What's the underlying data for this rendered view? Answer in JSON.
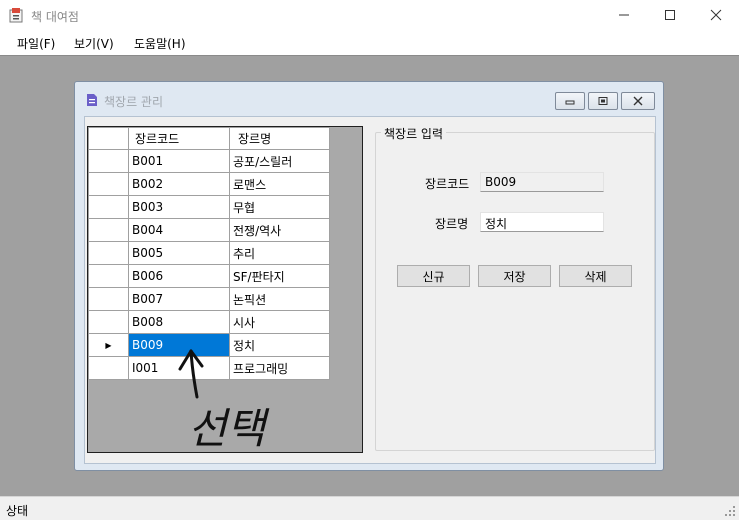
{
  "window": {
    "title": "책 대여점"
  },
  "menu": {
    "items": [
      "파일(F)",
      "보기(V)",
      "도움말(H)"
    ]
  },
  "child_window": {
    "title": "책장르 관리"
  },
  "grid": {
    "columns": [
      "장르코드",
      "장르명"
    ],
    "rows": [
      [
        "B001",
        "공포/스릴러"
      ],
      [
        "B002",
        "로맨스"
      ],
      [
        "B003",
        "무협"
      ],
      [
        "B004",
        "전쟁/역사"
      ],
      [
        "B005",
        "추리"
      ],
      [
        "B006",
        "SF/판타지"
      ],
      [
        "B007",
        "논픽션"
      ],
      [
        "B008",
        "시사"
      ],
      [
        "B009",
        "정치"
      ],
      [
        "I001",
        "프로그래밍"
      ]
    ],
    "selected_row": 8,
    "current_row_marker": "▶"
  },
  "form": {
    "group_title": "책장르 입력",
    "code_label": "장르코드",
    "code_value": "B009",
    "name_label": "장르명",
    "name_value": "정치",
    "buttons": {
      "new": "신규",
      "save": "저장",
      "delete": "삭제"
    }
  },
  "annotation": {
    "text": "선택"
  },
  "statusbar": {
    "label": "상태"
  },
  "colors": {
    "selection": "#0078d7",
    "mdi_background": "#a0a0a0"
  }
}
